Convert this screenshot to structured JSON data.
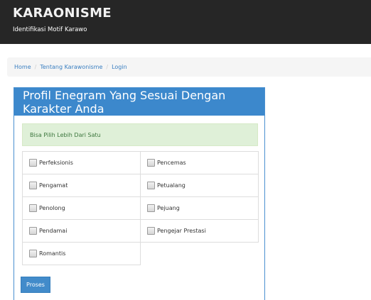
{
  "header": {
    "brand": "KARAONISME",
    "subtitle": "Identifikasi Motif Karawo",
    "background": "#262626"
  },
  "breadcrumb": {
    "items": [
      "Home",
      "Tentang Karawonisme",
      "Login"
    ]
  },
  "panel": {
    "title": "Profil Enegram Yang Sesuai Dengan Karakter Anda",
    "alert": "Bisa Pilih Lebih Dari Satu",
    "options": [
      {
        "label": "Perfeksionis",
        "checked": false
      },
      {
        "label": "Pencemas",
        "checked": false
      },
      {
        "label": "Pengamat",
        "checked": false
      },
      {
        "label": "Petualang",
        "checked": false
      },
      {
        "label": "Penolong",
        "checked": false
      },
      {
        "label": "Pejuang",
        "checked": false
      },
      {
        "label": "Pendamai",
        "checked": false
      },
      {
        "label": "Pengejar Prestasi",
        "checked": false
      },
      {
        "label": "Romantis",
        "checked": false
      }
    ],
    "submit_label": "Proses",
    "accent": "#3c88cc"
  }
}
